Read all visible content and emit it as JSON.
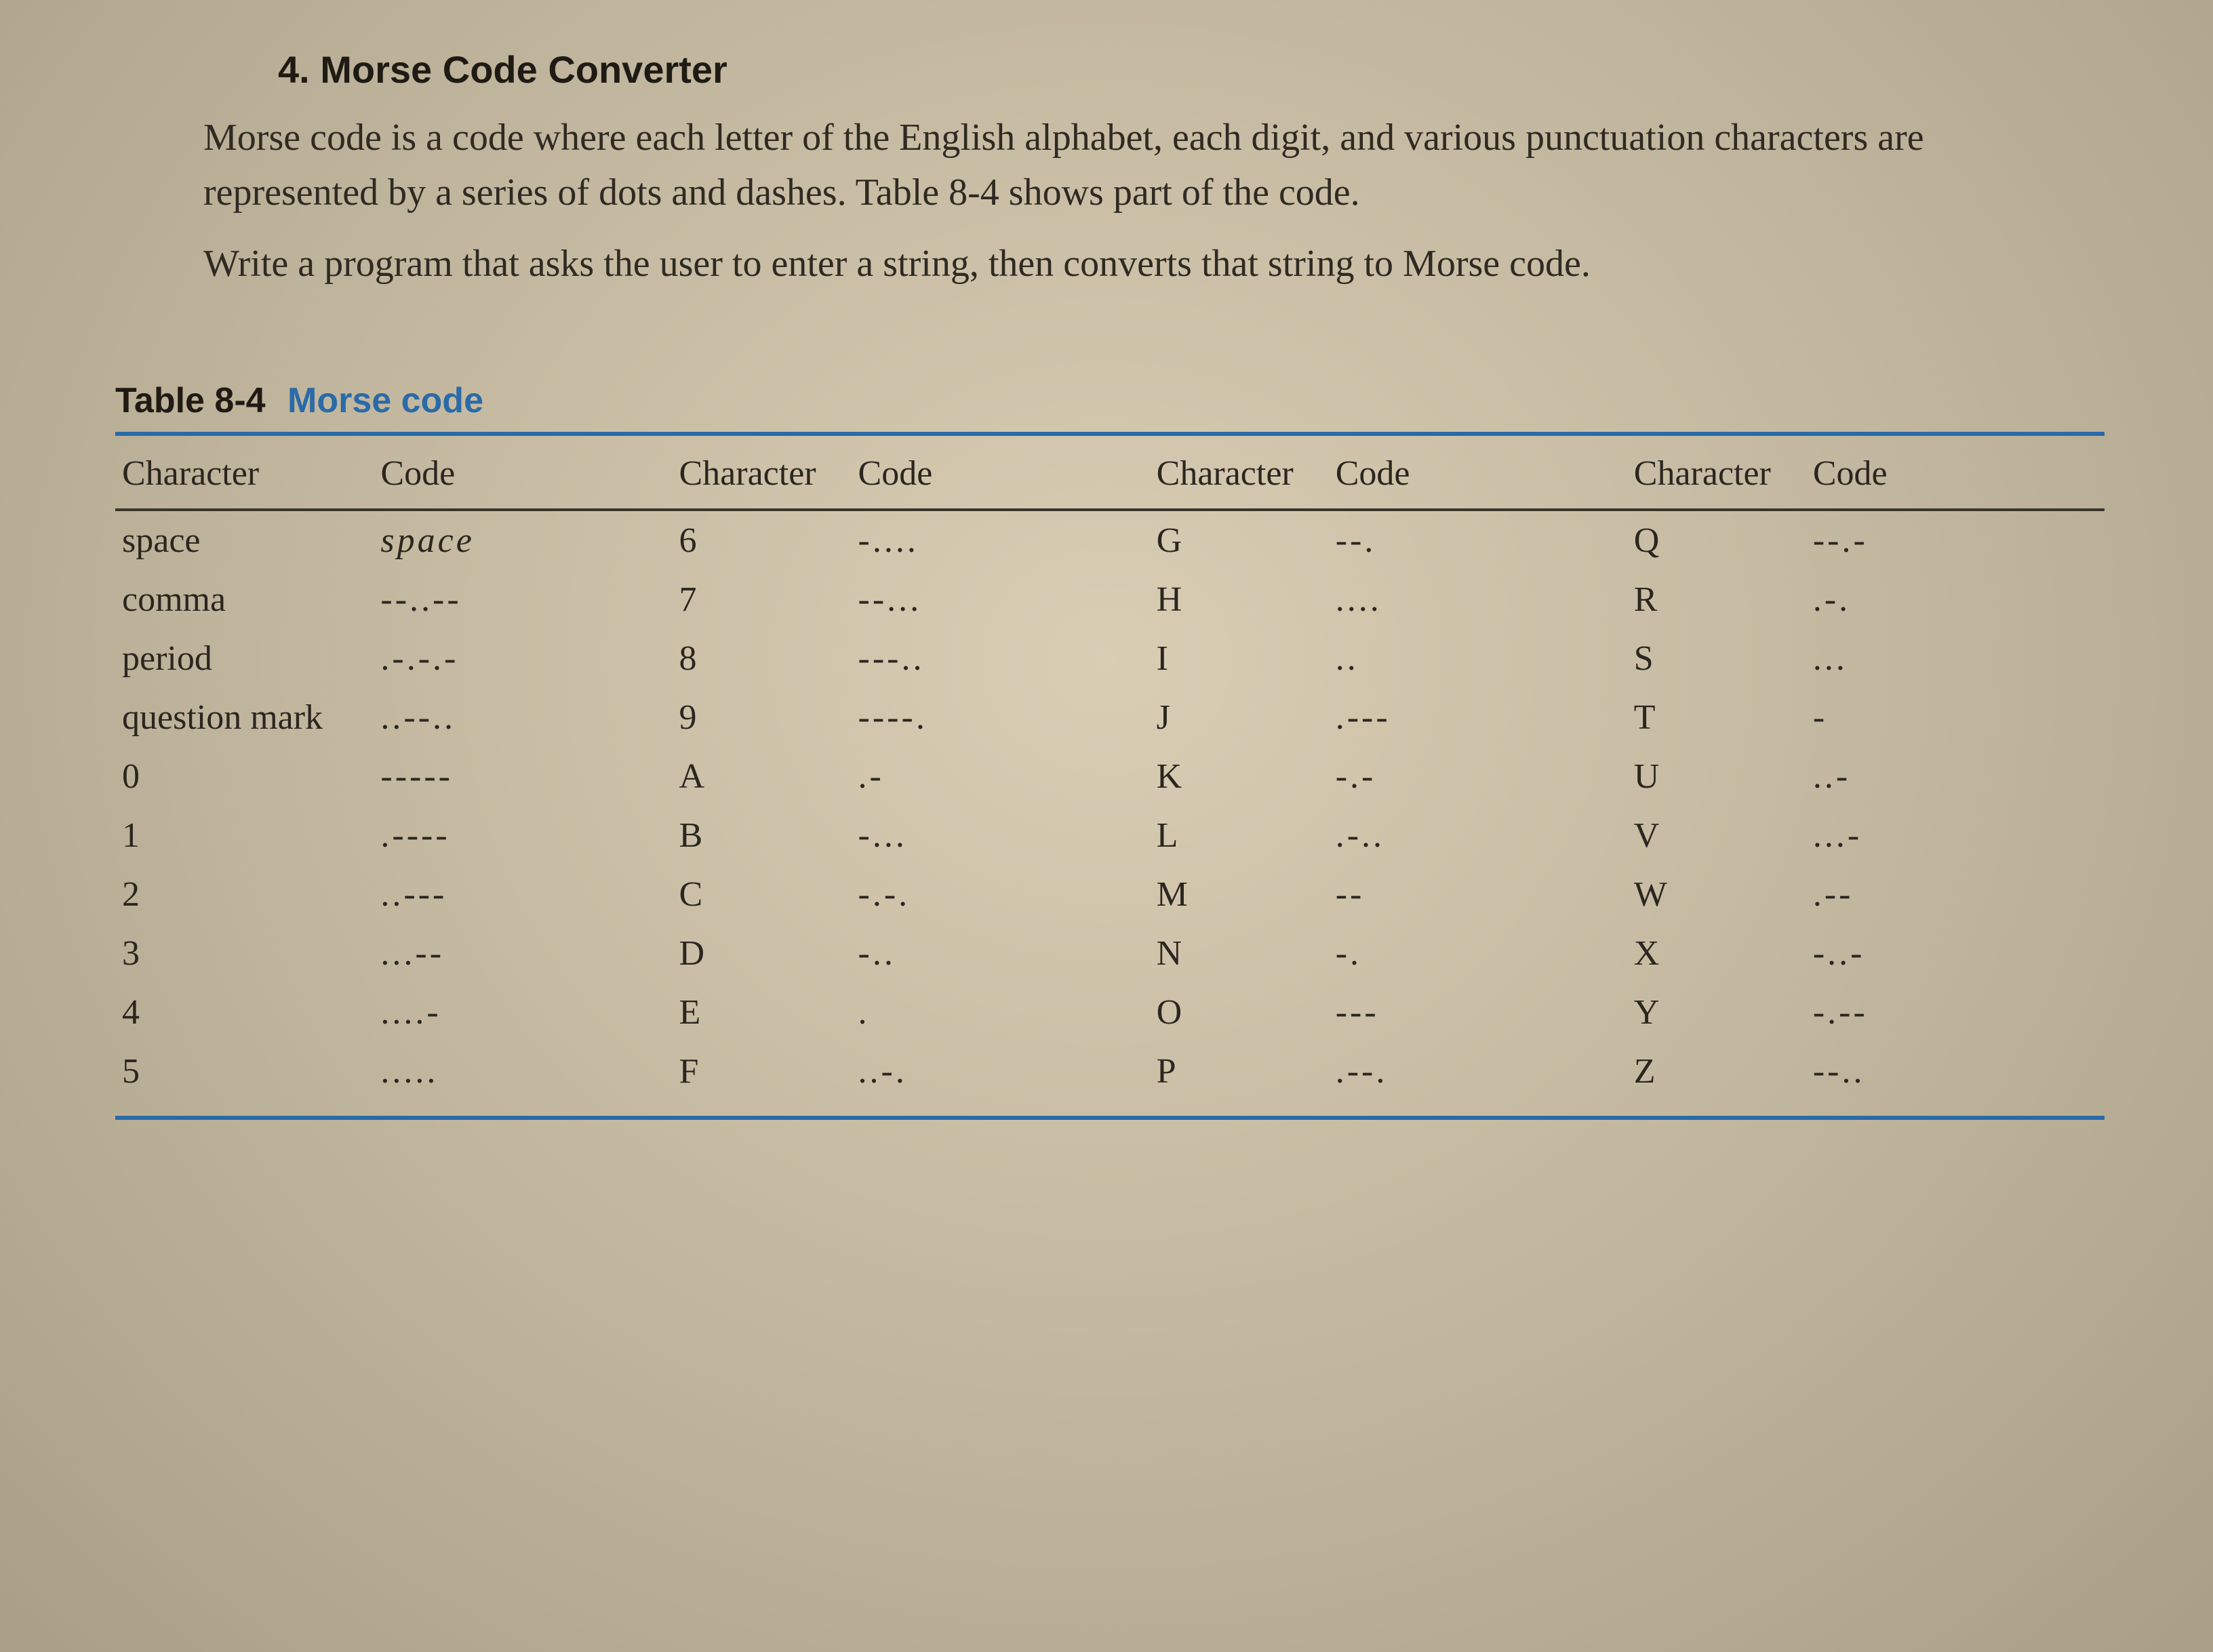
{
  "problem": {
    "number_title": "4. Morse Code Converter",
    "para1": "Morse code is a code where each letter of the English alphabet, each digit, and various punctuation characters are represented by a series of dots and dashes. Table 8-4 shows part of the code.",
    "para2": "Write a program that asks the user to enter a string, then converts that string to Morse code."
  },
  "table": {
    "label": "Table 8-4",
    "title": "Morse code",
    "headers": [
      "Character",
      "Code",
      "Character",
      "Code",
      "Character",
      "Code",
      "Character",
      "Code"
    ],
    "rows": [
      {
        "c1": "space",
        "d1": "space",
        "c2": "6",
        "d2": "-....",
        "c3": "G",
        "d3": "--.",
        "c4": "Q",
        "d4": "--.-"
      },
      {
        "c1": "comma",
        "d1": "--..--",
        "c2": "7",
        "d2": "--...",
        "c3": "H",
        "d3": "....",
        "c4": "R",
        "d4": ".-."
      },
      {
        "c1": "period",
        "d1": ".-.-.-",
        "c2": "8",
        "d2": "---..",
        "c3": "I",
        "d3": "..",
        "c4": "S",
        "d4": "..."
      },
      {
        "c1": "question mark",
        "d1": "..--..",
        "c2": "9",
        "d2": "----.",
        "c3": "J",
        "d3": ".---",
        "c4": "T",
        "d4": "-"
      },
      {
        "c1": "0",
        "d1": "-----",
        "c2": "A",
        "d2": ".-",
        "c3": "K",
        "d3": "-.-",
        "c4": "U",
        "d4": "..-"
      },
      {
        "c1": "1",
        "d1": ".----",
        "c2": "B",
        "d2": "-...",
        "c3": "L",
        "d3": ".-..",
        "c4": "V",
        "d4": "...-"
      },
      {
        "c1": "2",
        "d1": "..---",
        "c2": "C",
        "d2": "-.-.",
        "c3": "M",
        "d3": "--",
        "c4": "W",
        "d4": ".--"
      },
      {
        "c1": "3",
        "d1": "...--",
        "c2": "D",
        "d2": "-..",
        "c3": "N",
        "d3": "-.",
        "c4": "X",
        "d4": "-..-"
      },
      {
        "c1": "4",
        "d1": "....-",
        "c2": "E",
        "d2": ".",
        "c3": "O",
        "d3": "---",
        "c4": "Y",
        "d4": "-.--"
      },
      {
        "c1": "5",
        "d1": ".....",
        "c2": "F",
        "d2": "..-.",
        "c3": "P",
        "d3": ".--.",
        "c4": "Z",
        "d4": "--.."
      }
    ]
  },
  "chart_data": {
    "type": "table",
    "title": "Table 8-4 Morse code",
    "columns": [
      "Character",
      "Code"
    ],
    "rows": [
      [
        "space",
        "space"
      ],
      [
        "comma",
        "--..--"
      ],
      [
        "period",
        ".-.-.-"
      ],
      [
        "question mark",
        "..--.."
      ],
      [
        "0",
        "-----"
      ],
      [
        "1",
        ".----"
      ],
      [
        "2",
        "..---"
      ],
      [
        "3",
        "...--"
      ],
      [
        "4",
        "....-"
      ],
      [
        "5",
        "....."
      ],
      [
        "6",
        "-...."
      ],
      [
        "7",
        "--..."
      ],
      [
        "8",
        "---.."
      ],
      [
        "9",
        "----."
      ],
      [
        "A",
        ".-"
      ],
      [
        "B",
        "-..."
      ],
      [
        "C",
        "-.-."
      ],
      [
        "D",
        "-.."
      ],
      [
        "E",
        "."
      ],
      [
        "F",
        "..-."
      ],
      [
        "G",
        "--."
      ],
      [
        "H",
        "...."
      ],
      [
        "I",
        ".."
      ],
      [
        "J",
        ".---"
      ],
      [
        "K",
        "-.-"
      ],
      [
        "L",
        ".-.."
      ],
      [
        "M",
        "--"
      ],
      [
        "N",
        "-."
      ],
      [
        "O",
        "---"
      ],
      [
        "P",
        ".--."
      ],
      [
        "Q",
        "--.-"
      ],
      [
        "R",
        ".-."
      ],
      [
        "S",
        "..."
      ],
      [
        "T",
        "-"
      ],
      [
        "U",
        "..-"
      ],
      [
        "V",
        "...-"
      ],
      [
        "W",
        ".--"
      ],
      [
        "X",
        "-..-"
      ],
      [
        "Y",
        "-.--"
      ],
      [
        "Z",
        "--.."
      ]
    ]
  }
}
